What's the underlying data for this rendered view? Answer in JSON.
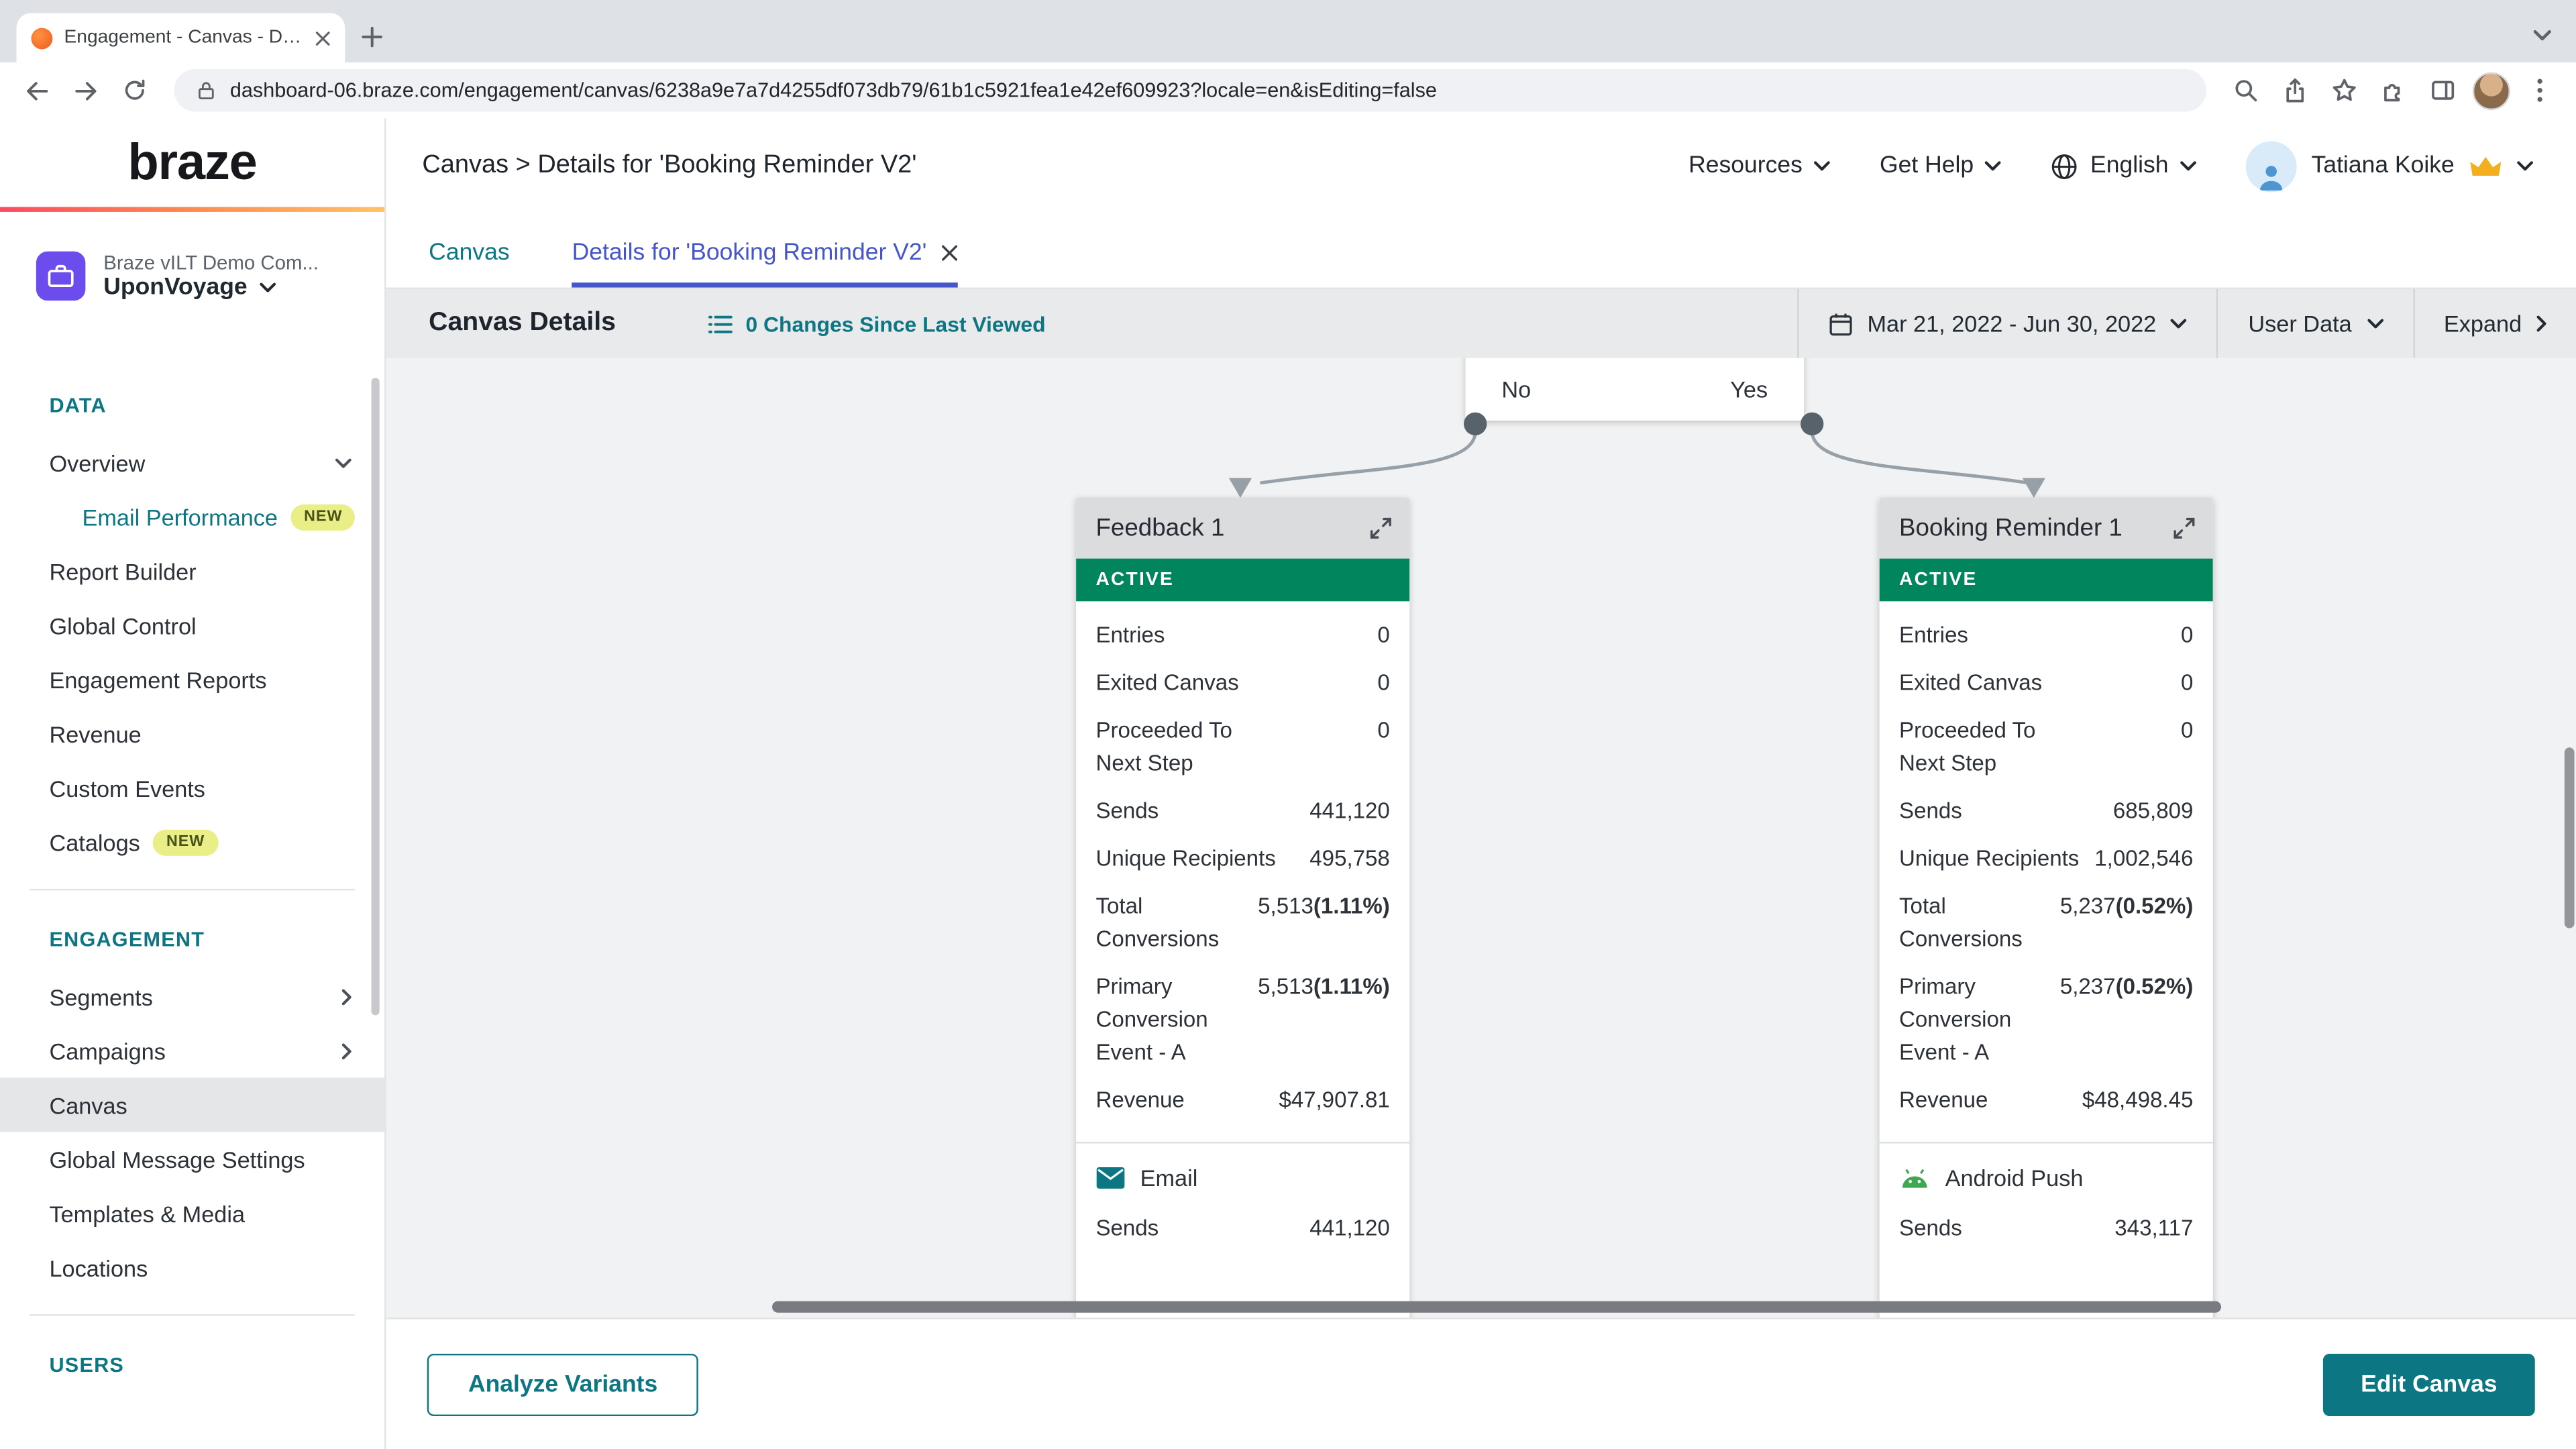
{
  "browser": {
    "tab_title": "Engagement - Canvas - Details",
    "url": "dashboard-06.braze.com/engagement/canvas/6238a9e7a7d4255df073db79/61b1c5921fea1e42ef609923?locale=en&isEditing=false"
  },
  "sidebar": {
    "brand": "braze",
    "company_name": "Braze vILT Demo Com...",
    "workspace": "UponVoyage",
    "sections": [
      {
        "title": "DATA",
        "divider": true,
        "items": [
          {
            "label": "Overview",
            "chevron": "down"
          },
          {
            "label": "Email Performance",
            "badge": "NEW",
            "indent": true,
            "teal": true
          },
          {
            "label": "Report Builder"
          },
          {
            "label": "Global Control"
          },
          {
            "label": "Engagement Reports"
          },
          {
            "label": "Revenue"
          },
          {
            "label": "Custom Events"
          },
          {
            "label": "Catalogs",
            "badge": "NEW"
          }
        ]
      },
      {
        "title": "ENGAGEMENT",
        "divider": true,
        "items": [
          {
            "label": "Segments",
            "chevron": "right"
          },
          {
            "label": "Campaigns",
            "chevron": "right"
          },
          {
            "label": "Canvas",
            "selected": true
          },
          {
            "label": "Global Message Settings"
          },
          {
            "label": "Templates & Media"
          },
          {
            "label": "Locations"
          }
        ]
      },
      {
        "title": "USERS",
        "items": []
      }
    ]
  },
  "header": {
    "breadcrumb": "Canvas > Details for 'Booking Reminder V2'",
    "resources_label": "Resources",
    "get_help_label": "Get Help",
    "language_label": "English",
    "user_name": "Tatiana Koike"
  },
  "tabs": {
    "canvas_label": "Canvas",
    "details_label": "Details for 'Booking Reminder V2'"
  },
  "details_bar": {
    "title": "Canvas Details",
    "changes_label": "0 Changes Since Last Viewed",
    "date_range": "Mar 21, 2022 - Jun 30, 2022",
    "user_data_label": "User Data",
    "expand_label": "Expand"
  },
  "flow": {
    "branch_labels": [
      "No",
      "Yes"
    ],
    "cards": [
      {
        "title": "Feedback 1",
        "status": "ACTIVE",
        "stats": [
          {
            "label": "Entries",
            "value": "0"
          },
          {
            "label": "Exited Canvas",
            "value": "0"
          },
          {
            "label": "Proceeded To Next Step",
            "value": "0"
          },
          {
            "label": "Sends",
            "value": "441,120"
          },
          {
            "label": "Unique Recipients",
            "value": "495,758"
          },
          {
            "label": "Total Conversions",
            "value": "5,513",
            "pct": "(1.11%)"
          },
          {
            "label": "Primary Conversion Event - A",
            "value": "5,513",
            "pct": "(1.11%)"
          },
          {
            "label": "Revenue",
            "value": "$47,907.81"
          }
        ],
        "channel": {
          "label": "Email",
          "icon": "email-icon",
          "stats": [
            {
              "label": "Sends",
              "value": "441,120"
            }
          ]
        }
      },
      {
        "title": "Booking Reminder 1",
        "status": "ACTIVE",
        "stats": [
          {
            "label": "Entries",
            "value": "0"
          },
          {
            "label": "Exited Canvas",
            "value": "0"
          },
          {
            "label": "Proceeded To Next Step",
            "value": "0"
          },
          {
            "label": "Sends",
            "value": "685,809"
          },
          {
            "label": "Unique Recipients",
            "value": "1,002,546"
          },
          {
            "label": "Total Conversions",
            "value": "5,237",
            "pct": "(0.52%)"
          },
          {
            "label": "Primary Conversion Event - A",
            "value": "5,237",
            "pct": "(0.52%)"
          },
          {
            "label": "Revenue",
            "value": "$48,498.45"
          }
        ],
        "channel": {
          "label": "Android Push",
          "icon": "android-icon",
          "stats": [
            {
              "label": "Sends",
              "value": "343,117"
            }
          ]
        }
      }
    ]
  },
  "footer": {
    "analyze_label": "Analyze Variants",
    "edit_label": "Edit Canvas"
  },
  "colors": {
    "brand_teal": "#0d7683",
    "active_tab_indigo": "#4655c8",
    "status_active_green": "#00855c",
    "new_badge_bg": "#e9ef86",
    "brand_gradient": [
      "#fb4a60",
      "#ff8a50",
      "#ffc266"
    ]
  },
  "icons": {
    "favicon": "orange-braze-dot",
    "language": "globe",
    "user_tier": "crown",
    "channel_email": "envelope",
    "channel_android_push": "android-robot",
    "changes": "bulleted-list",
    "date_range": "calendar"
  }
}
